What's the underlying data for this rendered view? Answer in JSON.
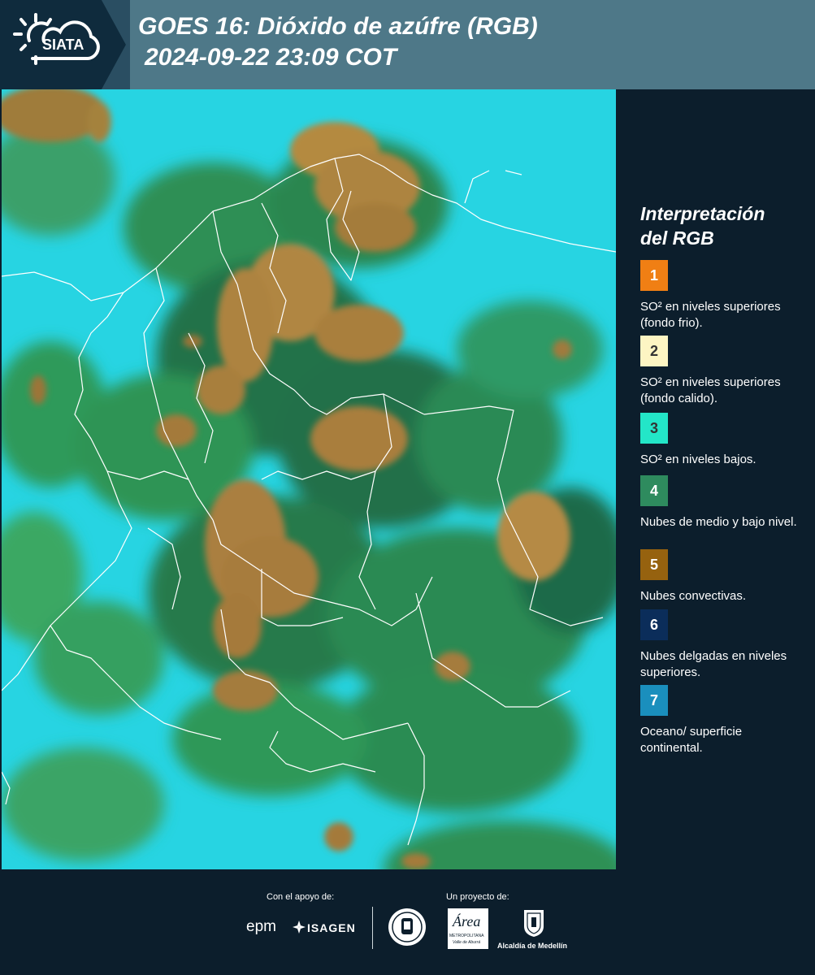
{
  "header": {
    "logo_text": "SIATA",
    "title_line1": "GOES 16: Dióxido de azúfre (RGB)",
    "title_line2": "2024-09-22 23:09 COT"
  },
  "legend": {
    "title_line1": "Interpretación",
    "title_line2": "del RGB",
    "items": [
      {
        "num": "1",
        "color": "#f07f14",
        "label": "SO² en niveles superiores (fondo frio)."
      },
      {
        "num": "2",
        "color": "#fdf5c3",
        "label": "SO² en niveles superiores (fondo calido)."
      },
      {
        "num": "3",
        "color": "#23e6c8",
        "label": "SO² en niveles bajos."
      },
      {
        "num": "4",
        "color": "#2e8b5e",
        "label": "Nubes de medio y bajo nivel."
      },
      {
        "num": "5",
        "color": "#96620f",
        "label": "Nubes convectivas."
      },
      {
        "num": "6",
        "color": "#0b2d5a",
        "label": "Nubes delgadas en niveles superiores."
      },
      {
        "num": "7",
        "color": "#1a8fbd",
        "label": "Oceano/ superficie continental."
      }
    ]
  },
  "footer": {
    "support_label": "Con el apoyo de:",
    "project_label": "Un proyecto de:",
    "epm": "epm",
    "isagen": "ISAGEN",
    "area_metro": "Área",
    "area_metro_sub": "METROPOLITANA",
    "area_metro_sub2": "Valle de Aburrá",
    "alcaldia": "Alcaldía de Medellín"
  }
}
